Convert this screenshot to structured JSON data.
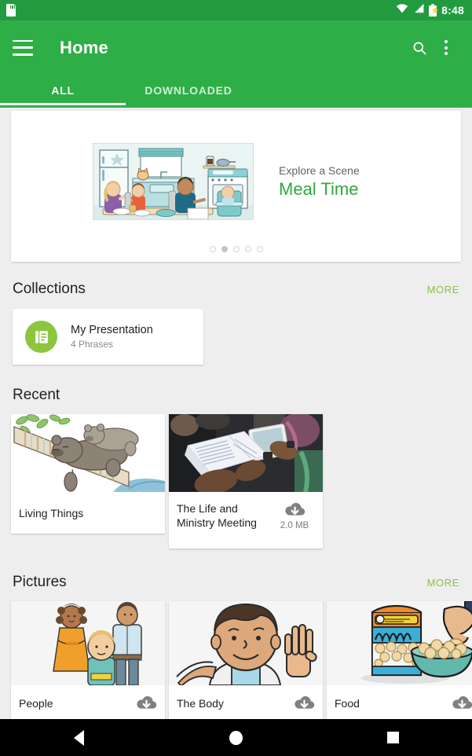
{
  "status_bar": {
    "sd_card_icon": "sd-card-icon",
    "wifi_icon": "wifi-icon",
    "signal_icon": "cell-signal-icon",
    "battery_icon": "battery-charging-icon",
    "time": "8:48"
  },
  "app_bar": {
    "menu_icon": "hamburger-menu-icon",
    "title": "Home",
    "search_icon": "search-icon",
    "overflow_icon": "more-vertical-icon",
    "accent_color": "#2eae46",
    "status_color": "#229b3e"
  },
  "tabs": [
    {
      "label": "ALL",
      "active": true
    },
    {
      "label": "DOWNLOADED",
      "active": false
    }
  ],
  "banner": {
    "kicker": "Explore a Scene",
    "title": "Meal Time",
    "title_color": "#30a83f",
    "image_alt": "family-eating-in-kitchen-illustration",
    "dots_total": 5,
    "dot_active_index": 1
  },
  "collections": {
    "title": "Collections",
    "more_label": "MORE",
    "more_color": "#8cc04a",
    "items": [
      {
        "icon": "document-list-icon",
        "icon_bg": "#8cc63f",
        "name": "My Presentation",
        "subtitle": "4 Phrases"
      }
    ]
  },
  "recent": {
    "title": "Recent",
    "items": [
      {
        "title": "Living Things",
        "image_alt": "bears-sleeping-on-tree-branch-illustration",
        "download": null,
        "size": null
      },
      {
        "title": "The Life and Ministry Meeting",
        "image_alt": "people-reading-publication-photo",
        "download": "cloud-download-icon",
        "size": "2.0 MB"
      }
    ]
  },
  "pictures": {
    "title": "Pictures",
    "more_label": "MORE",
    "items": [
      {
        "title": "People",
        "image_alt": "family-of-three-illustration",
        "download": "cloud-download-icon"
      },
      {
        "title": "The Body",
        "image_alt": "boy-waving-hand-illustration",
        "download": "cloud-download-icon"
      },
      {
        "title": "Food",
        "image_alt": "snack-bag-and-bowl-illustration",
        "download": "cloud-download-icon"
      }
    ]
  },
  "nav_bar": {
    "back_label": "Back",
    "home_label": "Home",
    "recents_label": "Recents"
  }
}
